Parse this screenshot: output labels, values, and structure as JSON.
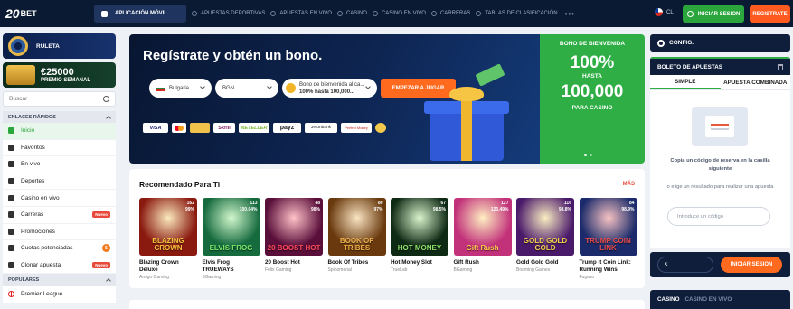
{
  "header": {
    "logo_num": "20",
    "logo_word": "BET",
    "app_button": "APLICACIÓN MÓVIL",
    "nav": [
      "APUESTAS DEPORTIVAS",
      "APUESTAS EN VIVO",
      "CASINO",
      "CASINO EN VIVO",
      "CARRERAS",
      "TABLAS DE CLASIFICACIÓN"
    ],
    "more": "•••",
    "lang": "CL",
    "login": "INICIAR SESION",
    "register": "REGISTRATE"
  },
  "sidebar": {
    "roulette": "RULETA",
    "jackpot_amount": "€25000",
    "jackpot_label": "PREMIO SEMANAL",
    "search_placeholder": "Buscar",
    "quick_links_title": "ENLACES RÁPIDOS",
    "items": [
      {
        "label": "Inicio",
        "icon": "home-icon"
      },
      {
        "label": "Favoritos",
        "icon": "star-icon"
      },
      {
        "label": "En vivo",
        "icon": "live-icon"
      },
      {
        "label": "Deportes",
        "icon": "ball-icon"
      },
      {
        "label": "Casino en vivo",
        "icon": "chip-icon"
      },
      {
        "label": "Carreras",
        "icon": "horse-icon",
        "badge": "Nuevo"
      },
      {
        "label": "Promociones",
        "icon": "gift-icon"
      },
      {
        "label": "Cuotas potenciadas",
        "icon": "boost-icon",
        "count": "5"
      },
      {
        "label": "Clonar apuesta",
        "icon": "clone-icon",
        "badge": "Nuevo"
      }
    ],
    "popular_title": "POPULARES",
    "popular": [
      {
        "label": "Premier League",
        "icon": "england-flag-icon"
      }
    ]
  },
  "hero": {
    "title": "Regístrate y obtén un bono.",
    "country": "Bulgaria",
    "currency": "BGN",
    "bonus_line1": "Bono de bienvenida al ca...",
    "bonus_line2": "100% hasta 100,000...",
    "cta": "EMPEZAR A JUGAR",
    "payments": [
      "VISA",
      "",
      "",
      "Skrill",
      "NETELLER",
      "payz",
      "Jetonbank",
      "Perfect Money",
      ""
    ],
    "green_title": "BONO DE BIENVENIDA",
    "green_pct": "100%",
    "green_hasta": "HASTA",
    "green_amount": "100,000",
    "green_sub": "PARA CASINO"
  },
  "recommended": {
    "title": "Recomendado Para Ti",
    "more": "MÁS",
    "games": [
      {
        "name": "Blazing Crown Deluxe",
        "provider": "Amigo Gaming",
        "players": "162",
        "rtp": "99%",
        "art": "BLAZING CROWN",
        "bg": "#8a1a10",
        "fg": "#f4c23a"
      },
      {
        "name": "Elvis Frog TRUEWAYS",
        "provider": "BGaming",
        "players": "113",
        "rtp": "100.04%",
        "art": "ELVIS FROG",
        "bg": "#156a3e",
        "fg": "#7be86a"
      },
      {
        "name": "20 Boost Hot",
        "provider": "Felix Gaming",
        "players": "48",
        "rtp": "98%",
        "art": "20 BOOST HOT",
        "bg": "#5a0e3a",
        "fg": "#ff4a5a"
      },
      {
        "name": "Book Of Tribes",
        "provider": "Spinomenal",
        "players": "80",
        "rtp": "97%",
        "art": "BOOK OF TRIBES",
        "bg": "#6a3a0e",
        "fg": "#f0b04a"
      },
      {
        "name": "Hot Money Slot",
        "provider": "TrueLab",
        "players": "67",
        "rtp": "98.5%",
        "art": "HOT MONEY",
        "bg": "#0f2a14",
        "fg": "#8ee06a"
      },
      {
        "name": "Gift Rush",
        "provider": "BGaming",
        "players": "127",
        "rtp": "123.49%",
        "art": "Gift Rush",
        "bg": "#c2327a",
        "fg": "#ffd34a"
      },
      {
        "name": "Gold Gold Gold",
        "provider": "Booming Games",
        "players": "116",
        "rtp": "98.8%",
        "art": "GOLD GOLD GOLD",
        "bg": "#4a1a6a",
        "fg": "#f4cf4a"
      },
      {
        "name": "Trump It Coin Link: Running Wins",
        "provider": "Fugaso",
        "players": "84",
        "rtp": "98.9%",
        "art": "TRUMP COIN LINK",
        "bg": "#1a2a6a",
        "fg": "#e84a4a"
      }
    ]
  },
  "right": {
    "config": "CONFIG.",
    "slip_title": "BOLETO DE APUESTAS",
    "tab_simple": "SIMPLE",
    "tab_combo": "APUESTA COMBINADA",
    "hint1": "Copia un código de reserva en la casilla siguiente",
    "hint2": "o elige un resultado para realizar una apuesta",
    "code_placeholder": "Introduce un código",
    "amount_value": "€",
    "login": "INICIAR SESION",
    "bottom_tabs": [
      "CASINO",
      "CASINO EN VIVO"
    ]
  },
  "colors": {
    "accent_green": "#2fae45",
    "accent_orange": "#ff6a1f",
    "navy": "#0b1a33",
    "badge_red": "#e8493a"
  }
}
